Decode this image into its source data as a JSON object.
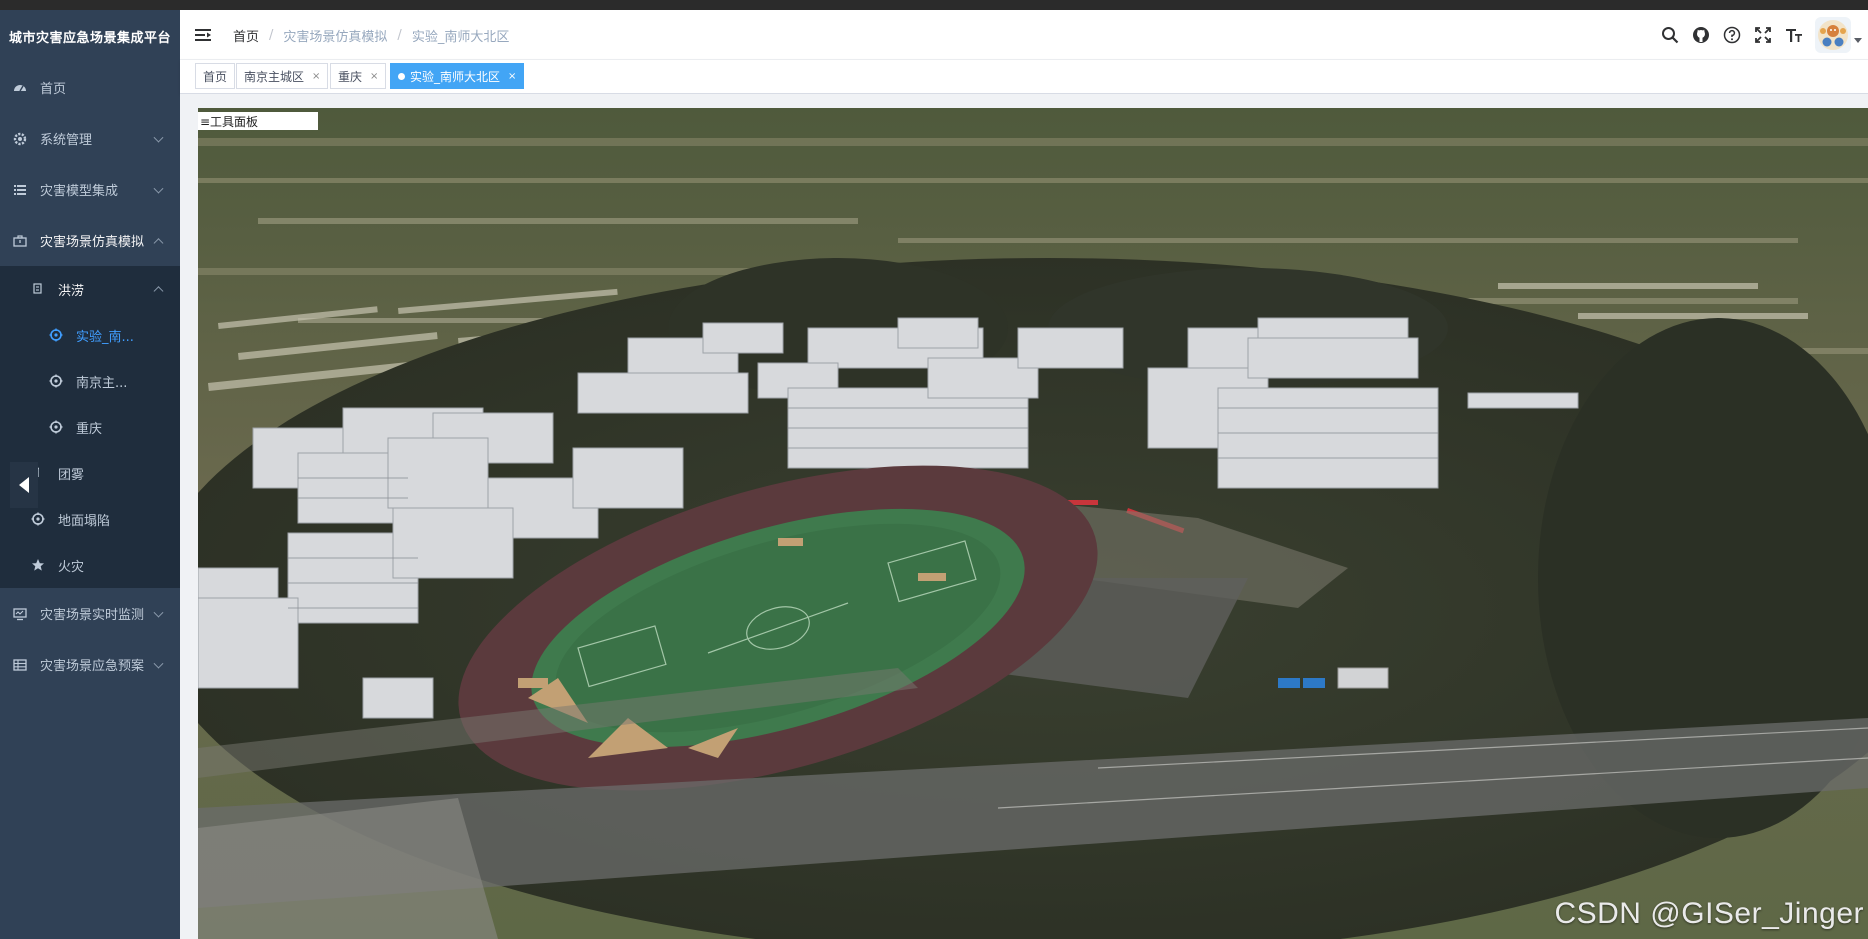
{
  "app": {
    "title": "城市灾害应急场景集成平台"
  },
  "sidebar": {
    "items": [
      {
        "label": "首页",
        "icon": "dashboard-icon"
      },
      {
        "label": "系统管理",
        "icon": "gear-icon"
      },
      {
        "label": "灾害模型集成",
        "icon": "list-icon"
      },
      {
        "label": "灾害场景仿真模拟",
        "icon": "toolbox-icon"
      },
      {
        "label": "灾害场景实时监测",
        "icon": "monitor-icon"
      },
      {
        "label": "灾害场景应急预案",
        "icon": "table-icon"
      }
    ],
    "sub_items": [
      {
        "label": "洪涝",
        "icon": "flood-icon"
      },
      {
        "label": "团雾",
        "icon": "fog-icon"
      },
      {
        "label": "地面塌陷",
        "icon": "crosshair-icon"
      },
      {
        "label": "火灾",
        "icon": "star-icon"
      }
    ],
    "flood_items": [
      {
        "label": "实验_南...",
        "icon": "crosshair-icon"
      },
      {
        "label": "南京主...",
        "icon": "crosshair-icon"
      },
      {
        "label": "重庆",
        "icon": "crosshair-icon"
      }
    ]
  },
  "navbar": {
    "breadcrumb": [
      "首页",
      "灾害场景仿真模拟",
      "实验_南师大北区"
    ],
    "icons": [
      "search-icon",
      "github-icon",
      "help-icon",
      "fullscreen-icon",
      "font-size-icon"
    ]
  },
  "tags": [
    {
      "label": "首页",
      "active": false,
      "closable": false
    },
    {
      "label": "南京主城区",
      "active": false,
      "closable": true
    },
    {
      "label": "重庆",
      "active": false,
      "closable": true
    },
    {
      "label": "实验_南师大北区",
      "active": true,
      "closable": true
    }
  ],
  "tag_close_glyph": "×",
  "scene": {
    "tool_panel_label": "≡工具面板",
    "watermark": "CSDN @GISer_Jinger"
  },
  "colors": {
    "sidebar_bg": "#304156",
    "submenu_bg": "#1f2d3d",
    "active_text": "#409eff",
    "active_tag": "#42a5f5"
  }
}
